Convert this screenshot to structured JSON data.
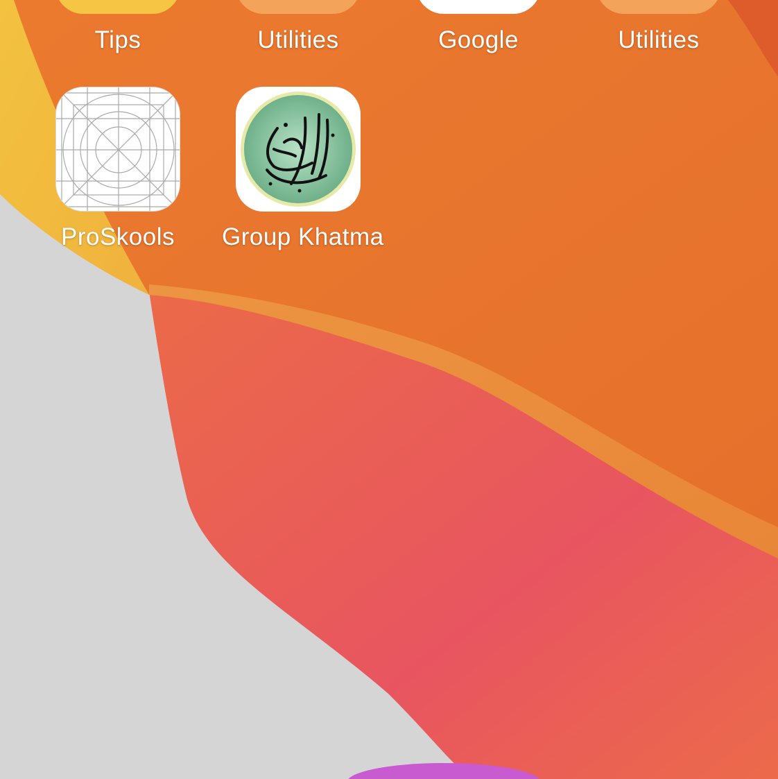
{
  "home_screen": {
    "row1": [
      {
        "label": "Tips",
        "icon": "tips-icon",
        "icon_color": "#F7C544"
      },
      {
        "label": "Utilities",
        "icon": "utilities-folder-icon",
        "icon_color": "#F4A35A"
      },
      {
        "label": "Google",
        "icon": "google-icon",
        "icon_color": "#FFFFFF"
      },
      {
        "label": "Utilities",
        "icon": "utilities-folder-icon",
        "icon_color": "#F4A35A"
      }
    ],
    "row2": [
      {
        "label": "ProSkools",
        "icon": "blank-template-grid-icon",
        "icon_color": "#FFFFFF"
      },
      {
        "label": "Group Khatma",
        "icon": "quran-calligraphy-icon",
        "icon_color": "#8FC9A5"
      }
    ]
  },
  "colors": {
    "wallpaper_orange": "#E8742E",
    "wallpaper_red": "#E8595E",
    "wallpaper_yellow": "#F4C542",
    "wallpaper_gray": "#D6D6D6",
    "label_text": "#FFFFFF"
  }
}
